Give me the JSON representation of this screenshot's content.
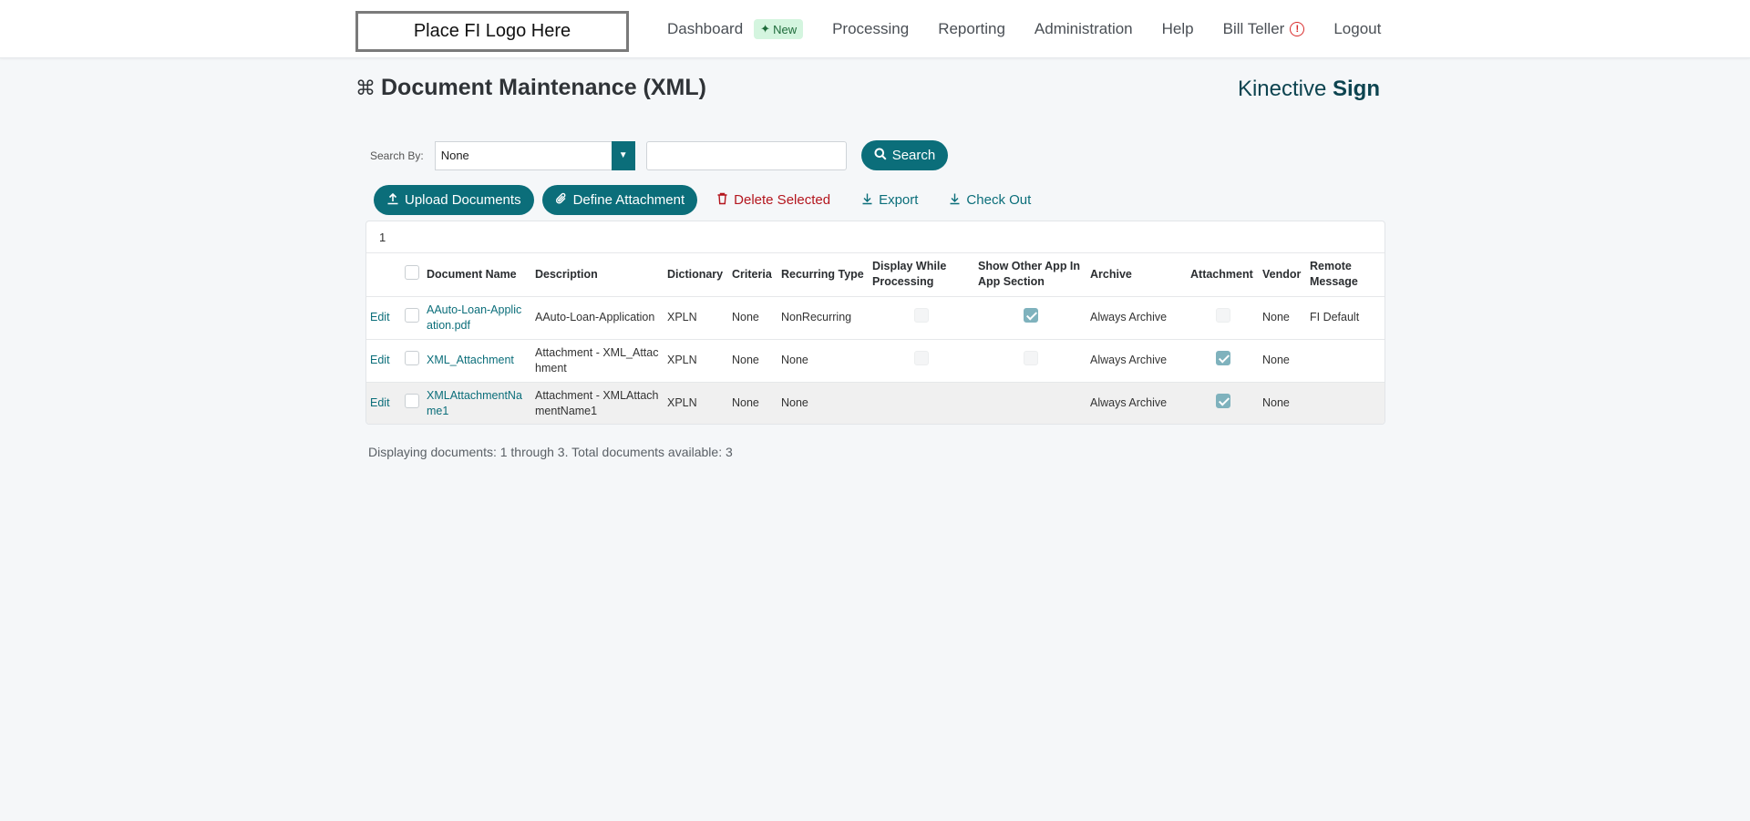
{
  "header": {
    "logo_text": "Place FI Logo Here",
    "nav": [
      {
        "label": "Dashboard",
        "badge": "New"
      },
      {
        "label": "Processing"
      },
      {
        "label": "Reporting"
      },
      {
        "label": "Administration"
      },
      {
        "label": "Help"
      },
      {
        "label": "Bill Teller"
      },
      {
        "label": "Logout"
      }
    ]
  },
  "page": {
    "title": "Document Maintenance (XML)",
    "brand_light": "Kinective",
    "brand_bold": "Sign"
  },
  "search": {
    "label": "Search By:",
    "select_value": "None",
    "input_value": "",
    "button_label": "Search"
  },
  "actions": {
    "upload": "Upload Documents",
    "define": "Define Attachment",
    "delete": "Delete Selected",
    "export": "Export",
    "checkout": "Check Out"
  },
  "table": {
    "page": "1",
    "columns": [
      "Document Name",
      "Description",
      "Dictionary",
      "Criteria",
      "Recurring Type",
      "Display While Processing",
      "Show Other App In App Section",
      "Archive",
      "Attachment",
      "Vendor",
      "Remote Message"
    ],
    "rows": [
      {
        "edit": "Edit",
        "name": "AAuto-Loan-Application.pdf",
        "description": "AAuto-Loan-Application",
        "dictionary": "XPLN",
        "criteria": "None",
        "recurring": "NonRecurring",
        "display_while": "unchecked",
        "show_other": "checked",
        "archive": "Always Archive",
        "attachment": "unchecked",
        "vendor": "None",
        "remote": "FI Default"
      },
      {
        "edit": "Edit",
        "name": "XML_Attachment",
        "description": "Attachment - XML_Attachment",
        "dictionary": "XPLN",
        "criteria": "None",
        "recurring": "None",
        "display_while": "unchecked",
        "show_other": "unchecked",
        "archive": "Always Archive",
        "attachment": "checked",
        "vendor": "None",
        "remote": ""
      },
      {
        "edit": "Edit",
        "name": "XMLAttachmentName1",
        "description": "Attachment - XMLAttachmentName1",
        "dictionary": "XPLN",
        "criteria": "None",
        "recurring": "None",
        "display_while": "none",
        "show_other": "none",
        "archive": "Always Archive",
        "attachment": "checked",
        "vendor": "None",
        "remote": ""
      }
    ]
  },
  "footer": {
    "status": "Displaying documents: 1 through 3. Total documents available: 3"
  },
  "colors": {
    "accent": "#0b6e7a",
    "danger": "#b4161e",
    "badge_bg": "#d4f5df"
  }
}
